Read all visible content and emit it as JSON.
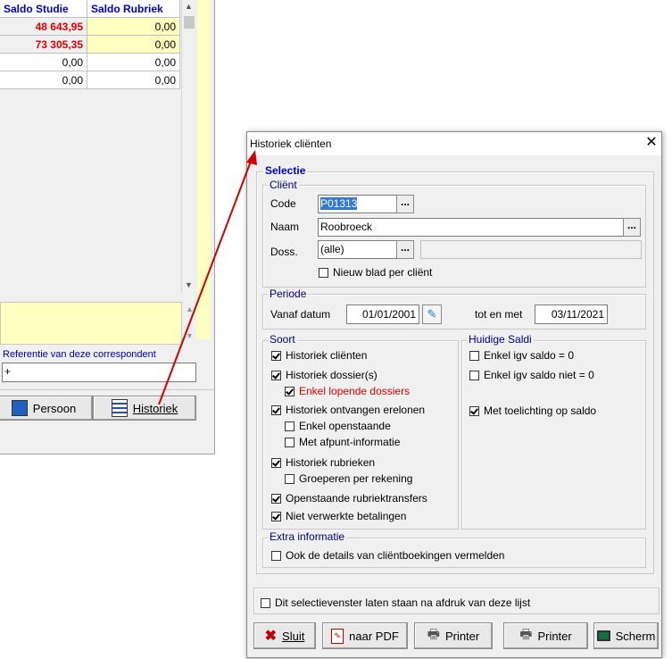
{
  "background_window": {
    "columns": [
      "Saldo Studie",
      "Saldo Rubriek"
    ],
    "rows": [
      {
        "studie": "48 643,95",
        "rubriek": "0,00",
        "highlight": true
      },
      {
        "studie": "73 305,35",
        "rubriek": "0,00",
        "highlight": true
      },
      {
        "studie": "0,00",
        "rubriek": "0,00",
        "highlight": false
      },
      {
        "studie": "0,00",
        "rubriek": "0,00",
        "highlight": false
      }
    ],
    "referentie_label": "Referentie van deze correspondent",
    "referentie_value": "+",
    "persoon_button": "Persoon",
    "historiek_button": "Historiek"
  },
  "dialog": {
    "title": "Historiek cliënten",
    "selectie_label": "Selectie",
    "client_group": {
      "legend": "Cliënt",
      "code_label": "Code",
      "code_value": "P01313",
      "naam_label": "Naam",
      "naam_value": "Roobroeck",
      "doss_label": "Doss.",
      "doss_value": "(alle)",
      "nieuw_blad": {
        "label": "Nieuw blad per cliënt",
        "checked": false
      }
    },
    "periode_group": {
      "legend": "Periode",
      "vanaf_label": "Vanaf datum",
      "vanaf_value": "01/01/2001",
      "tot_label": "tot en met",
      "tot_value": "03/11/2021"
    },
    "soort_group": {
      "legend": "Soort",
      "items": [
        {
          "label": "Historiek cliënten",
          "checked": true
        },
        {
          "label": "Historiek dossier(s)",
          "checked": true
        },
        {
          "label": "Enkel lopende dossiers",
          "checked": true
        },
        {
          "label": "Historiek ontvangen erelonen",
          "checked": true
        },
        {
          "label": "Enkel openstaande",
          "checked": false
        },
        {
          "label": "Met afpunt-informatie",
          "checked": false
        },
        {
          "label": "Historiek rubrieken",
          "checked": true
        },
        {
          "label": "Groeperen per rekening",
          "checked": false
        },
        {
          "label": "Openstaande rubriektransfers",
          "checked": true
        },
        {
          "label": "Niet verwerkte betalingen",
          "checked": true
        }
      ]
    },
    "saldi_group": {
      "legend": "Huidige Saldi",
      "items": [
        {
          "label": "Enkel igv saldo = 0",
          "checked": false
        },
        {
          "label": "Enkel igv saldo niet = 0",
          "checked": false
        },
        {
          "label": "Met toelichting op saldo",
          "checked": true
        }
      ]
    },
    "extra_group": {
      "legend": "Extra informatie",
      "item": {
        "label": "Ook de details van cliëntboekingen vermelden",
        "checked": false
      }
    },
    "laten_staan": {
      "label": "Dit selectievenster laten staan na afdruk van deze lijst",
      "checked": false
    },
    "buttons": {
      "sluit": "Sluit",
      "pdf": "naar PDF",
      "printer1": "Printer",
      "printer2": "Printer",
      "scherm": "Scherm"
    }
  },
  "colors": {
    "accent_red": "#e00000",
    "header_blue": "#0000cc",
    "yellow": "#ffffc0"
  }
}
